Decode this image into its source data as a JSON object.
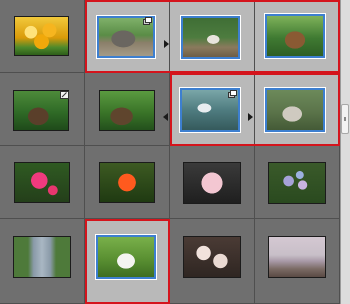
{
  "view": "thumbnail-grid",
  "scrollbar": {
    "grip_icon": "scroll-grip-icon"
  },
  "thumbnails": [
    {
      "id": "tulips",
      "icon": "photo-thumbnail"
    },
    {
      "id": "elephant",
      "icon": "photo-thumbnail",
      "badge": "stack-icon"
    },
    {
      "id": "goats",
      "icon": "photo-thumbnail"
    },
    {
      "id": "tiger-resting",
      "icon": "photo-thumbnail"
    },
    {
      "id": "tiger-edited",
      "icon": "photo-thumbnail",
      "badge": "edit-icon"
    },
    {
      "id": "tiger-copy",
      "icon": "photo-thumbnail"
    },
    {
      "id": "polar-bear",
      "icon": "photo-thumbnail",
      "badge": "stack-icon"
    },
    {
      "id": "cat",
      "icon": "photo-thumbnail"
    },
    {
      "id": "rose-pink",
      "icon": "photo-thumbnail"
    },
    {
      "id": "rose-orange",
      "icon": "photo-thumbnail"
    },
    {
      "id": "rose-light-pink",
      "icon": "photo-thumbnail"
    },
    {
      "id": "hydrangea",
      "icon": "photo-thumbnail"
    },
    {
      "id": "street-trees",
      "icon": "photo-thumbnail"
    },
    {
      "id": "rabbit",
      "icon": "photo-thumbnail"
    },
    {
      "id": "cherry-blossom-closeup",
      "icon": "photo-thumbnail"
    },
    {
      "id": "cherry-blossom-path",
      "icon": "photo-thumbnail"
    }
  ]
}
